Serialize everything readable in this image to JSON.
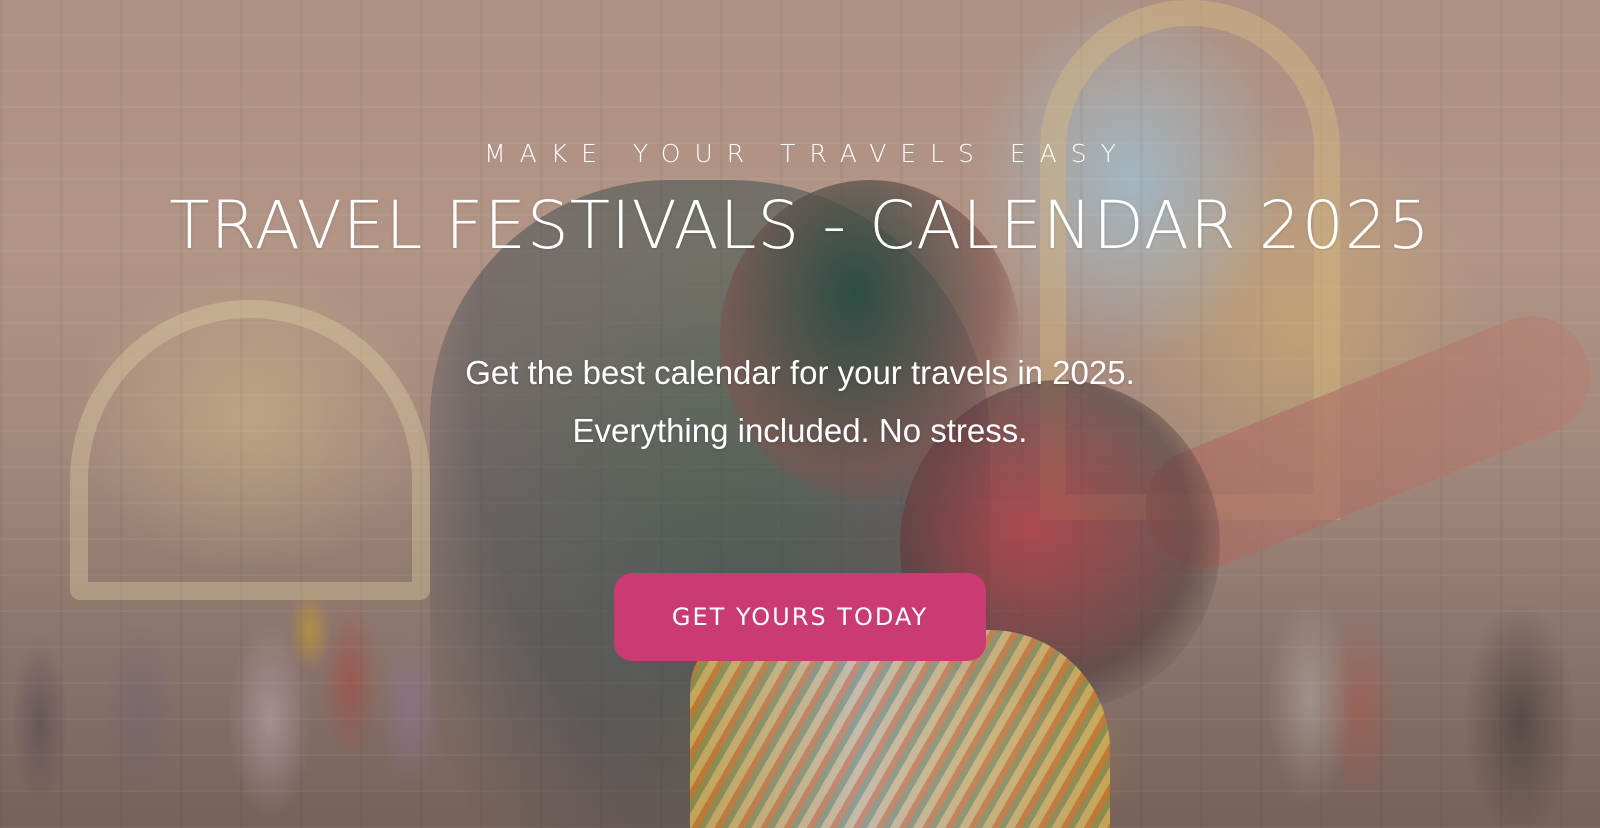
{
  "hero": {
    "eyebrow": "MAKE YOUR TRAVELS EASY",
    "title": "TRAVEL FESTIVALS - CALENDAR 2025",
    "subtitle_line1": "Get the best calendar for your travels in 2025.",
    "subtitle_line2": "Everything included. No stress.",
    "cta_label": "GET YOURS TODAY",
    "cta_color": "#c93b72",
    "text_color": "#ffffff"
  }
}
